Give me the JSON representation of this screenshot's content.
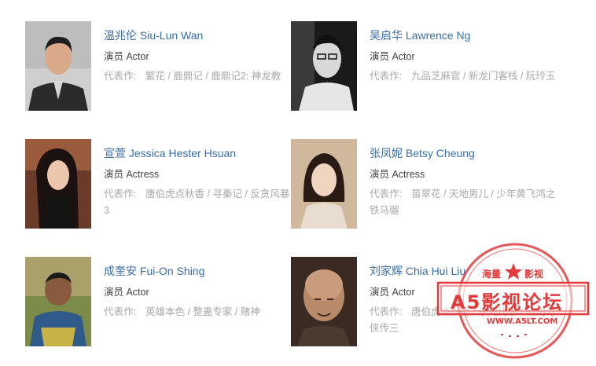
{
  "people": [
    {
      "name": "温兆伦 Siu-Lun Wan",
      "role": "演员 Actor",
      "works_label": "代表作:",
      "works": "繁花 / 鹿鼎记 / 鹿鼎记2: 神龙教"
    },
    {
      "name": "吴启华 Lawrence Ng",
      "role": "演员 Actor",
      "works_label": "代表作:",
      "works": "九品芝麻官 / 新龙门客栈 / 阮玲玉"
    },
    {
      "name": "宣萱 Jessica Hester Hsuan",
      "role": "演员 Actress",
      "works_label": "代表作:",
      "works": "唐伯虎点秋香 / 寻秦记 / 反贪风暴3"
    },
    {
      "name": "张凤妮 Betsy Cheung",
      "role": "演员 Actress",
      "works_label": "代表作:",
      "works": "苗翠花 / 天地男儿 / 少年黄飞鸿之铁马骝"
    },
    {
      "name": "成奎安 Fui-On Shing",
      "role": "演员 Actor",
      "works_label": "代表作:",
      "works": "英雄本色 / 整蛊专家 / 赌神"
    },
    {
      "name": "刘家辉 Chia Hui Liu",
      "role": "演员 Actor",
      "works_label": "代表作:",
      "works": "唐伯虎点秋香 / 杀死比尔 / 仙剑奇侠传三"
    }
  ],
  "watermark": {
    "top_left": "海量",
    "top_right": "影视",
    "main": "A5影视论坛",
    "url": "WWW.A5LT.COM"
  },
  "colors": {
    "link": "#3b6ea5",
    "muted": "#a8a8a8",
    "stamp": "#e23a3a"
  }
}
